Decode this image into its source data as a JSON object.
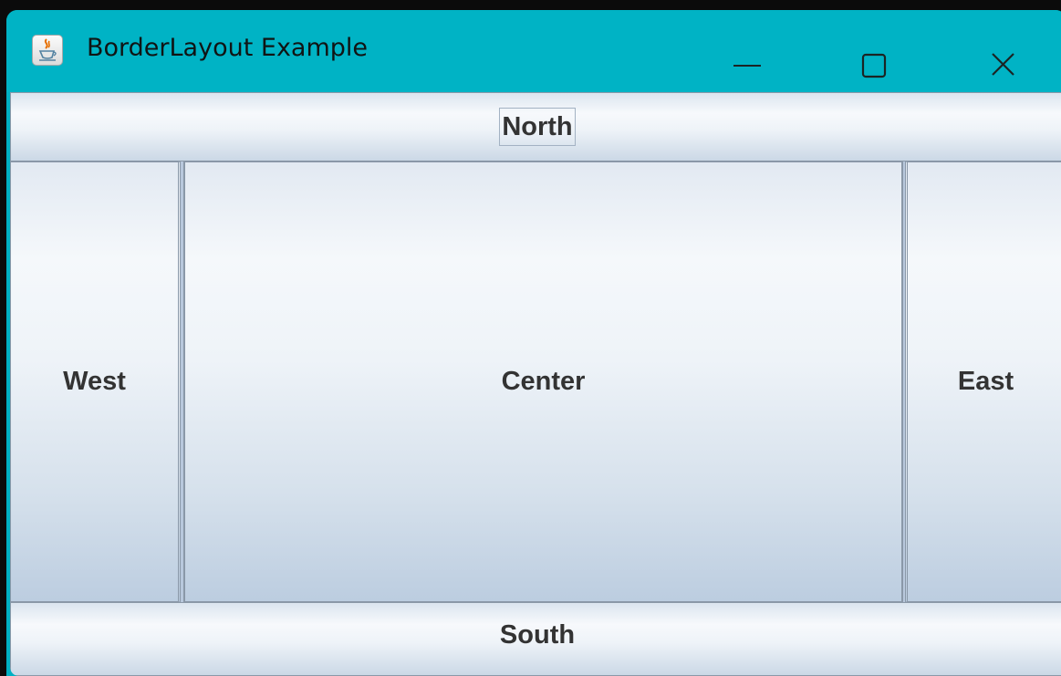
{
  "window": {
    "title": "BorderLayout Example",
    "icon": "java-cup-icon",
    "titlebar_color": "#00b3c5",
    "controls": [
      "minimize-icon",
      "maximize-icon",
      "close-icon"
    ]
  },
  "layout": {
    "north": "North",
    "west": "West",
    "center": "Center",
    "east": "East",
    "south": "South"
  }
}
